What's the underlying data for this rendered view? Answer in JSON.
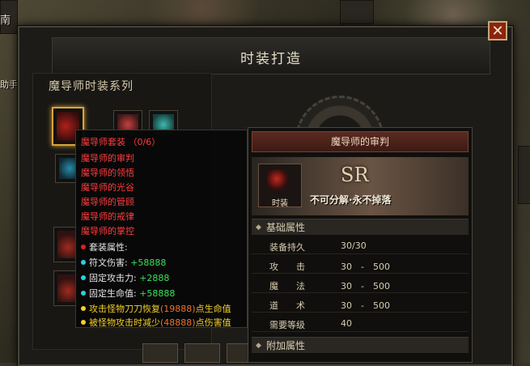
{
  "side_labels": {
    "left_top": "南",
    "left_mid": "助手"
  },
  "window": {
    "title": "时装打造",
    "close_label": "✕"
  },
  "left_panel": {
    "series_title": "魔导师时装系列"
  },
  "set_tooltip": {
    "set_name": "魔导师套装",
    "set_count": "（0/6）",
    "pieces": [
      "魔导师的审判",
      "魔导师的领悟",
      "魔导师的光谷",
      "魔导师的管顾",
      "魔导师的戒律",
      "魔导师的掌控"
    ],
    "set_attr_label": "套装属性:",
    "stats": [
      {
        "label": "符文伤害:",
        "value": "+58888"
      },
      {
        "label": "固定攻击力:",
        "value": "+2888"
      },
      {
        "label": "固定生命值:",
        "value": "+58888"
      }
    ],
    "effects": [
      {
        "pre": "攻击怪物刀刀恢复",
        "num": "(19888)",
        "post": "点生命值"
      },
      {
        "pre": "被怪物攻击时减少",
        "num": "(48888)",
        "post": "点伤害值"
      }
    ]
  },
  "item_tooltip": {
    "name": "魔导师的审判",
    "rarity": "SR",
    "tag": "时装",
    "binding": "不可分解·永不掉落",
    "base_section": "基础属性",
    "attrs": [
      {
        "key": "装备持久",
        "value": "30/30"
      },
      {
        "key": "攻　　击",
        "value": "30　-　500"
      },
      {
        "key": "魔　　法",
        "value": "30　-　500"
      },
      {
        "key": "道　　术",
        "value": "30　-　500"
      },
      {
        "key": "需要等级",
        "value": "40"
      }
    ],
    "extra_section": "附加属性"
  },
  "colors": {
    "set_red": "#ff3c3c",
    "stat_green": "#39e05b",
    "effect_yellow": "#f1d02a",
    "accent_gold": "#d8a43a"
  }
}
